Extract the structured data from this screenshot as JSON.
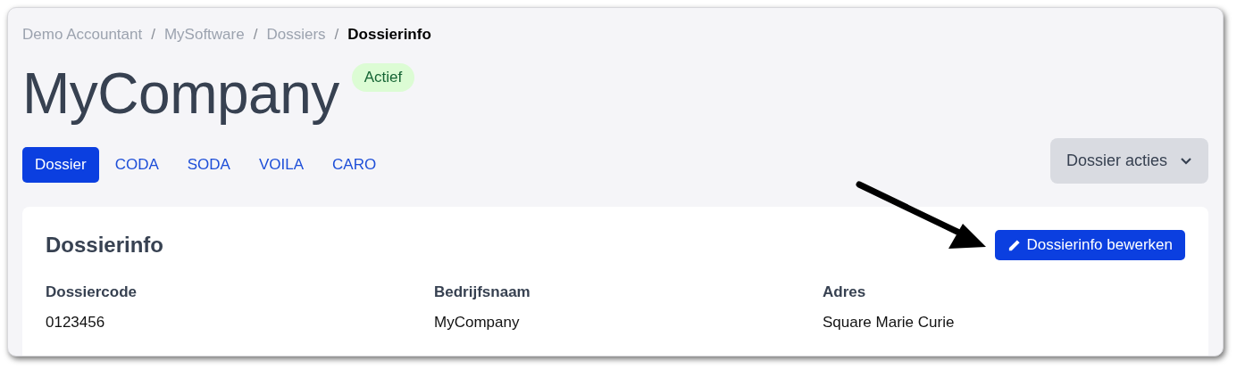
{
  "breadcrumb": [
    {
      "label": "Demo Accountant",
      "current": false
    },
    {
      "label": "MySoftware",
      "current": false
    },
    {
      "label": "Dossiers",
      "current": false
    },
    {
      "label": "Dossierinfo",
      "current": true
    }
  ],
  "breadcrumb_separator": "/",
  "title": "MyCompany",
  "status_badge": "Actief",
  "tabs": [
    {
      "label": "Dossier",
      "selected": true
    },
    {
      "label": "CODA",
      "selected": false
    },
    {
      "label": "SODA",
      "selected": false
    },
    {
      "label": "VOILA",
      "selected": false
    },
    {
      "label": "CARO",
      "selected": false
    }
  ],
  "actions_button": "Dossier acties",
  "card": {
    "title": "Dossierinfo",
    "edit_button": "Dossierinfo bewerken",
    "fields": [
      {
        "label": "Dossiercode",
        "value": "0123456"
      },
      {
        "label": "Bedrijfsnaam",
        "value": "MyCompany"
      },
      {
        "label": "Adres",
        "value": "Square Marie Curie"
      }
    ]
  }
}
